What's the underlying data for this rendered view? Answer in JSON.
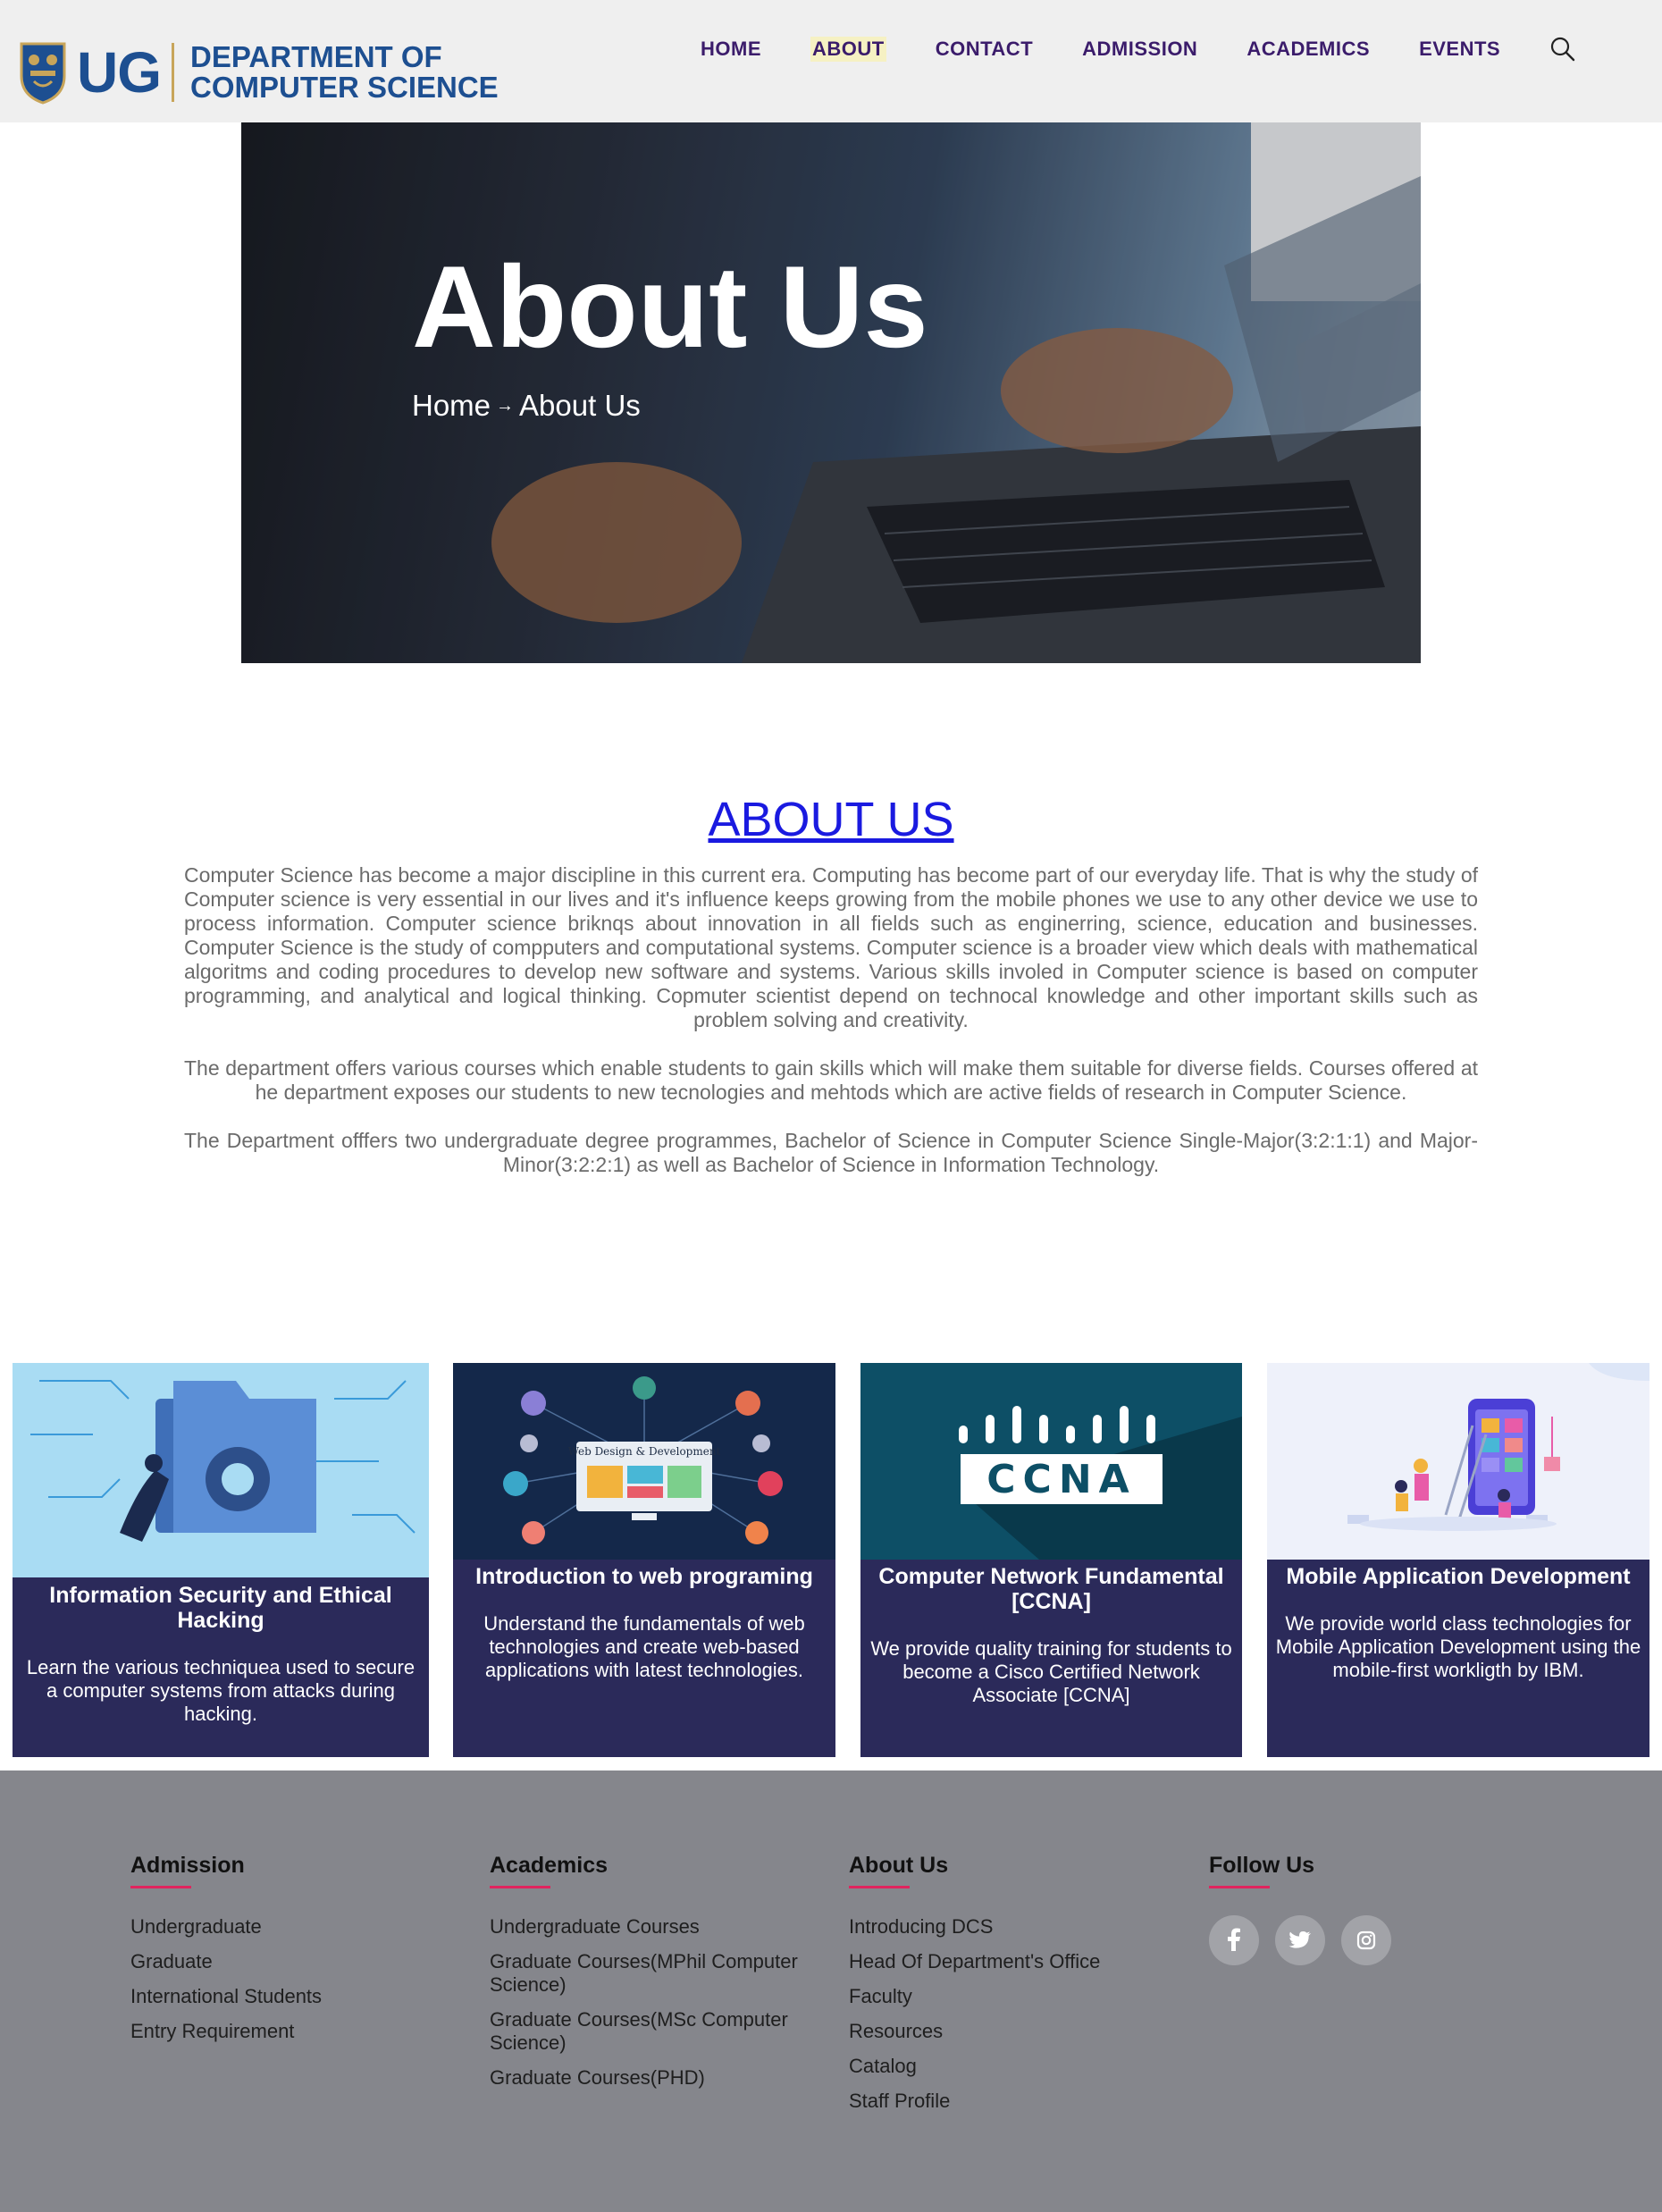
{
  "header": {
    "logo_ug": "UG",
    "logo_line1": "DEPARTMENT OF",
    "logo_line2": "COMPUTER SCIENCE",
    "nav": [
      "HOME",
      "ABOUT",
      "CONTACT",
      "ADMISSION",
      "ACADEMICS",
      "EVENTS"
    ],
    "active_nav": "ABOUT"
  },
  "hero": {
    "title": "About Us",
    "crumb_home": "Home",
    "crumb_arrow": "→",
    "crumb_current": "About Us"
  },
  "about": {
    "heading": "ABOUT US",
    "paragraphs": [
      "Computer Science has become a major discipline in this current era. Computing has become part of our everyday life. That is why the study of Computer science is very essential in our lives and it's influence keeps growing from the mobile phones we use to any other device we use to process information. Computer science briknqs about innovation in all fields such as enginerring, science, education and businesses. Computer Science is the study of compputers and computational systems. Computer science is a broader view which deals with mathematical algoritms and coding procedures to develop new software and systems. Various skills involed in Computer science is based on computer programming, and analytical and logical thinking. Copmuter scientist depend on technocal knowledge and other important skills such as problem solving and creativity.",
      "The department offers various courses which enable students to gain skills which will make them suitable for diverse fields. Courses offered at he department exposes our students to new tecnologies and mehtods which are active fields of research in Computer Science.",
      "The Department offfers two undergraduate degree programmes, Bachelor of Science in Computer Science Single-Major(3:2:1:1) and Major-Minor(3:2:2:1) as well as Bachelor of Science in Information Technology."
    ]
  },
  "courses": [
    {
      "image_label": "",
      "title": "Information Security and Ethical Hacking",
      "desc": "Learn the various techniquea used to secure a computer systems from attacks during hacking."
    },
    {
      "image_label": "Web Design & Development",
      "title": "Introduction to web programing",
      "desc": "Understand the fundamentals of web technologies and create web-based applications with latest technologies."
    },
    {
      "image_label": "CCNA",
      "title": "Computer Network Fundamental [CCNA]",
      "desc": "We provide quality training for students to become a Cisco Certified Network Associate [CCNA]"
    },
    {
      "image_label": "",
      "title": "Mobile Application Development",
      "desc": "We provide world class technologies for Mobile Application Development using the mobile-first workligth by IBM."
    }
  ],
  "footer": {
    "columns": [
      {
        "title": "Admission",
        "links": [
          "Undergraduate",
          "Graduate",
          "International Students",
          "Entry Requirement"
        ]
      },
      {
        "title": "Academics",
        "links": [
          "Undergraduate Courses",
          "Graduate Courses(MPhil Computer Science)",
          "Graduate Courses(MSc Computer Science)",
          "Graduate Courses(PHD)"
        ]
      },
      {
        "title": "About Us",
        "links": [
          "Introducing DCS",
          "Head Of Department's Office",
          "Faculty",
          "Resources",
          "Catalog",
          "Staff Profile"
        ]
      },
      {
        "title": "Follow Us",
        "links": []
      }
    ],
    "socials": [
      "facebook-icon",
      "twitter-icon",
      "instagram-icon"
    ]
  },
  "colors": {
    "nav_text": "#3b1c6b",
    "logo_blue": "#1d4f91",
    "card_bg": "#2b2a5a",
    "footer_bg": "#85868c",
    "accent_line": "#e0245e",
    "about_link": "#1a1ae0"
  }
}
